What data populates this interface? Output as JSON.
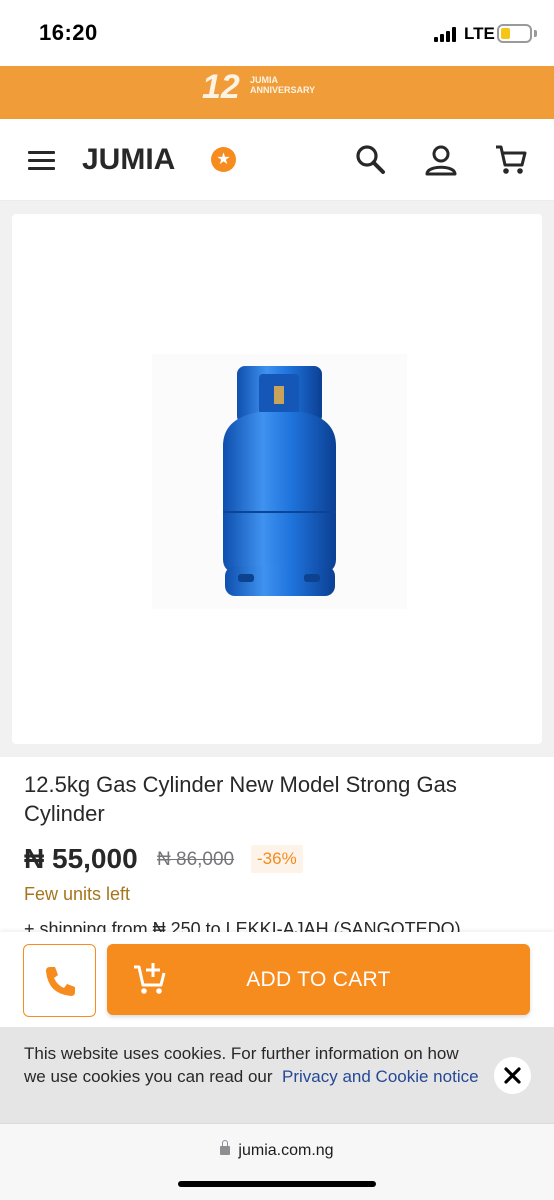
{
  "status_bar": {
    "time": "16:20",
    "network": "LTE",
    "battery_level": 0.35
  },
  "banner": {
    "number": "12",
    "line1": "JUMIA",
    "line2": "ANNIVERSARY"
  },
  "header": {
    "logo_text": "JUMIA",
    "icons": [
      "menu-icon",
      "search-icon",
      "account-icon",
      "cart-icon"
    ]
  },
  "product": {
    "title": "12.5kg Gas Cylinder New Model Strong Gas Cylinder",
    "price": "₦ 55,000",
    "old_price": "₦ 86,000",
    "discount": "-36%",
    "stock": "Few units left",
    "shipping": "+ shipping from ₦ 250 to LEKKI-AJAH (SANGOTEDO)"
  },
  "actions": {
    "add_to_cart": "ADD TO CART"
  },
  "cookie": {
    "text": "This website uses cookies. For further information on how we use cookies you can read our",
    "link": "Privacy and Cookie notice"
  },
  "browser": {
    "url": "jumia.com.ng"
  },
  "colors": {
    "brand_orange": "#f68b1e",
    "banner_orange": "#f09c38",
    "product_blue": "#1a6fd1"
  }
}
